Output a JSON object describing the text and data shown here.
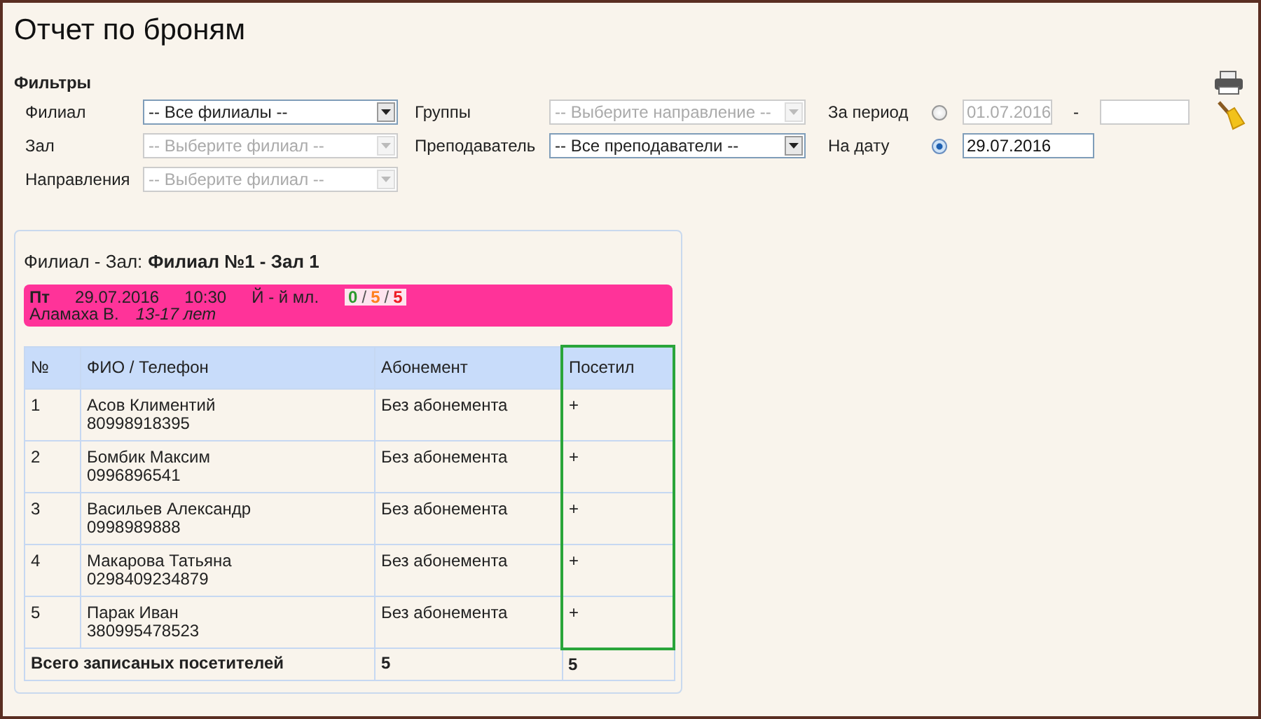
{
  "title": "Отчет по броням",
  "filters": {
    "heading": "Фильтры",
    "fields": [
      {
        "label": "Филиал",
        "value": "-- Все филиалы --",
        "disabled": false
      },
      {
        "label": "Группы",
        "value": "-- Выберите направление --",
        "disabled": true
      },
      {
        "label": "Зал",
        "value": "-- Выберите филиал --",
        "disabled": true
      },
      {
        "label": "Преподаватель",
        "value": "-- Все преподаватели --",
        "disabled": false
      },
      {
        "label": "Направления",
        "value": "-- Выберите филиал --",
        "disabled": true
      }
    ],
    "period": {
      "label": "За период",
      "selected": false,
      "from": "01.07.2016",
      "separator": "-"
    },
    "on_date": {
      "label": "На дату",
      "selected": true,
      "value": "29.07.2016"
    }
  },
  "report": {
    "location_label": "Филиал - Зал:",
    "location": "Филиал №1 - Зал 1",
    "session": {
      "day": "Пт",
      "date": "29.07.2016",
      "time": "10:30",
      "group": "Й - й мл.",
      "count_separator": "/",
      "counts": [
        {
          "value": "0",
          "color": "#2e9a2e"
        },
        {
          "value": "5",
          "color": "#ff7f1e"
        },
        {
          "value": "5",
          "color": "#ee1c24"
        }
      ],
      "teacher": "Аламаха В.",
      "age": "13-17 лет"
    },
    "columns": [
      {
        "label": "№",
        "highlighted": false
      },
      {
        "label": "ФИО / Телефон",
        "highlighted": false
      },
      {
        "label": "Абонемент",
        "highlighted": false
      },
      {
        "label": "Посетил",
        "highlighted": true
      }
    ],
    "rows": [
      {
        "no": "1",
        "name": "Асов Климентий",
        "phone": "80998918395",
        "subscription": "Без абонемента",
        "visited": "+"
      },
      {
        "no": "2",
        "name": "Бомбик Максим",
        "phone": "0996896541",
        "subscription": "Без абонемента",
        "visited": "+"
      },
      {
        "no": "3",
        "name": "Васильев Александр",
        "phone": "0998989888",
        "subscription": "Без абонемента",
        "visited": "+"
      },
      {
        "no": "4",
        "name": "Макарова Татьяна",
        "phone": "0298409234879",
        "subscription": "Без абонемента",
        "visited": "+"
      },
      {
        "no": "5",
        "name": "Парак Иван",
        "phone": "380995478523",
        "subscription": "Без абонемента",
        "visited": "+"
      }
    ],
    "total": {
      "label": "Всего записаных посетителей",
      "subscription": "5",
      "visited": "5"
    }
  }
}
